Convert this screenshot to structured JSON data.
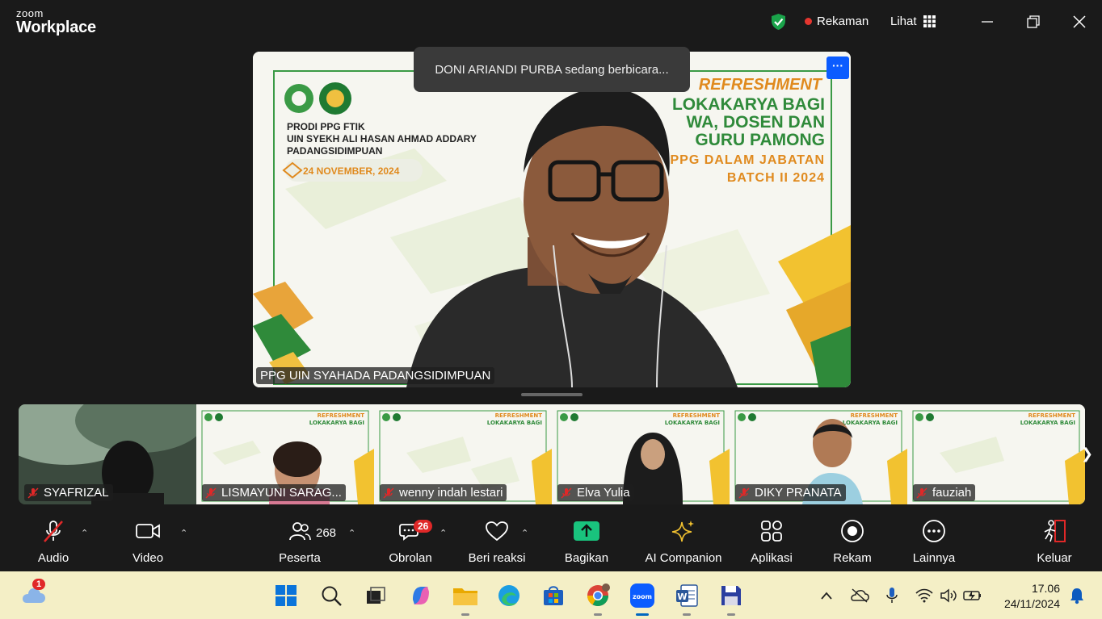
{
  "app": {
    "brand_line1": "zoom",
    "brand_line2": "Workplace",
    "recording_label": "Rekaman",
    "view_label": "Lihat"
  },
  "speaker": {
    "toast": "DONI ARIANDI PURBA sedang berbicara...",
    "name": "PPG UIN SYAHADA PADANGSIDIMPUAN",
    "more_label": "···"
  },
  "slide": {
    "org_line1": "PRODI PPG FTIK",
    "org_line2": "UIN SYEKH ALI HASAN AHMAD ADDARY",
    "org_line3": "PADANGSIDIMPUAN",
    "date": "24 NOVEMBER, 2024",
    "title1": "REFRESHMENT",
    "title2": "LOKAKARYA BAGI",
    "title3": "WA, DOSEN DAN",
    "title4": "GURU PAMONG",
    "title5": "PPG DALAM JABATAN",
    "title6": "BATCH II 2024"
  },
  "participants": [
    {
      "name": "SYAFRIZAL"
    },
    {
      "name": "LISMAYUNI SARAG..."
    },
    {
      "name": "wenny indah lestari"
    },
    {
      "name": "Elva Yulia"
    },
    {
      "name": "DIKY PRANATA"
    },
    {
      "name": "fauziah"
    }
  ],
  "toolbar": {
    "audio": "Audio",
    "video": "Video",
    "participants": "Peserta",
    "participants_count": "268",
    "chat": "Obrolan",
    "chat_badge": "26",
    "react": "Beri reaksi",
    "share": "Bagikan",
    "ai": "AI Companion",
    "apps": "Aplikasi",
    "record": "Rekam",
    "more": "Lainnya",
    "leave": "Keluar"
  },
  "taskbar": {
    "weather_badge": "1",
    "time": "17.06",
    "date": "24/11/2024"
  },
  "colors": {
    "accent_blue": "#0b5cff",
    "recording_red": "#e5362f",
    "share_green": "#19c37d",
    "taskbar_bg": "#f4efc6",
    "slide_green": "#2f8a3a",
    "slide_orange": "#e08a1e"
  }
}
